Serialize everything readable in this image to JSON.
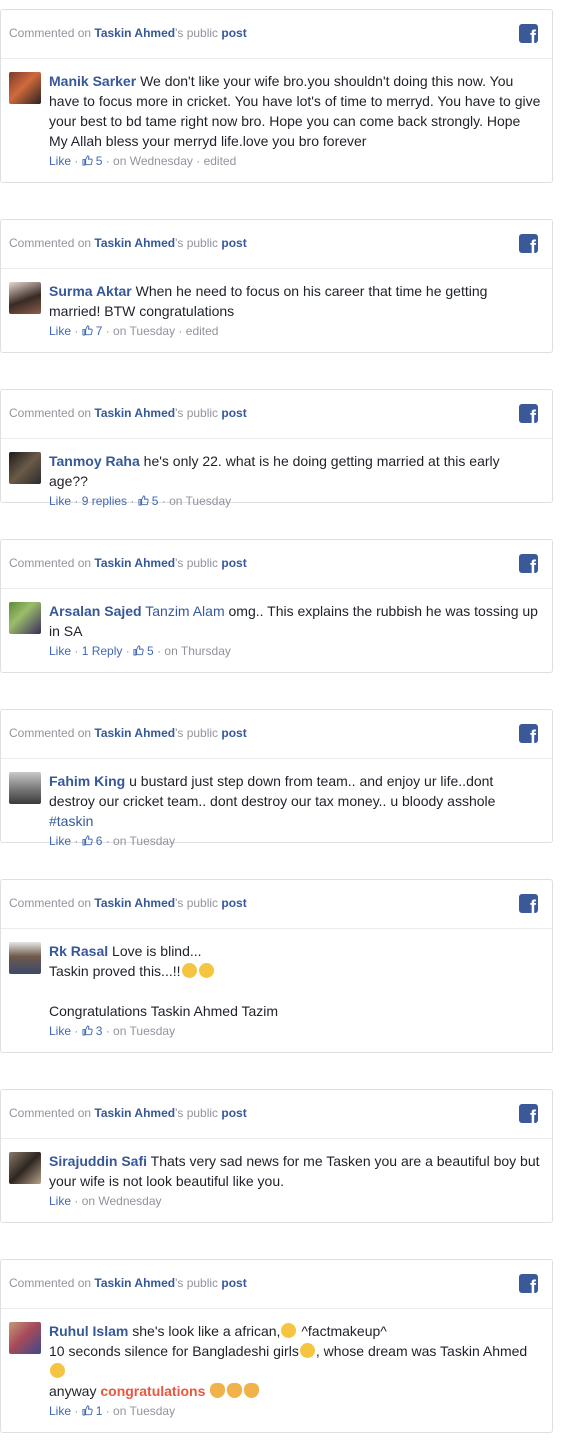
{
  "header": {
    "prefix": "Commented on ",
    "page": "Taskin Ahmed",
    "middle": "'s public ",
    "post": "post"
  },
  "meta_labels": {
    "like": "Like",
    "sep": " · "
  },
  "comments": [
    {
      "name": "Manik Sarker",
      "text": "We don't like your wife bro.you shouldn't doing this now. You have to focus more in cricket. You have lot's of time to merryd. You have to give your best to bd tame right now bro. Hope you can come back strongly. Hope My Allah bless your merryd life.love you bro forever",
      "likes": "5",
      "time": "on Wednesday",
      "edited": "edited"
    },
    {
      "name": "Surma Aktar",
      "text": "When he need to focus on his career that time he getting married! BTW congratulations",
      "likes": "7",
      "time": "on Tuesday",
      "edited": "edited"
    },
    {
      "name": "Tanmoy Raha",
      "text": "he's only 22. what is he doing getting married at this early age??",
      "replies": "9 replies",
      "likes": "5",
      "time": "on Tuesday"
    },
    {
      "name": "Arsalan Sajed",
      "tag": "Tanzim Alam",
      "text": "omg.. This explains the rubbish he was tossing up in SA",
      "replies": "1 Reply",
      "likes": "5",
      "time": "on Thursday"
    },
    {
      "name": "Fahim King",
      "text": "u bustard just step down from team.. and enjoy ur life..dont destroy our cricket team.. dont destroy our tax money.. u bloody asshole",
      "hashtag": "#taskin",
      "likes": "6",
      "time": "on Tuesday"
    },
    {
      "name": "Rk Rasal",
      "line1": "Love is blind...",
      "line2": "Taskin proved this...!!",
      "line3": "Congratulations Taskin Ahmed Tazim",
      "likes": "3",
      "time": "on Tuesday"
    },
    {
      "name": "Sirajuddin Safi",
      "text": "Thats very sad news for me Tasken you are a beautiful boy but your wife is not look beautiful like you.",
      "time": "on Wednesday"
    },
    {
      "name": "Ruhul Islam",
      "line1": "she's look like a african,",
      "line1b": " ^factmakeup^",
      "line2": "10 seconds silence for Bangladeshi girls",
      "line2b": ", whose dream was Taskin Ahmed",
      "line3": "anyway ",
      "congrats": "congratulations",
      "likes": "1",
      "time": "on Tuesday"
    }
  ],
  "icons": {
    "facebook": "f",
    "thumb": "thumbs-up-icon"
  },
  "colors": {
    "link": "#365899",
    "meta": "#90949c",
    "fb": "#3b5998",
    "congrats": "#e9573f"
  }
}
